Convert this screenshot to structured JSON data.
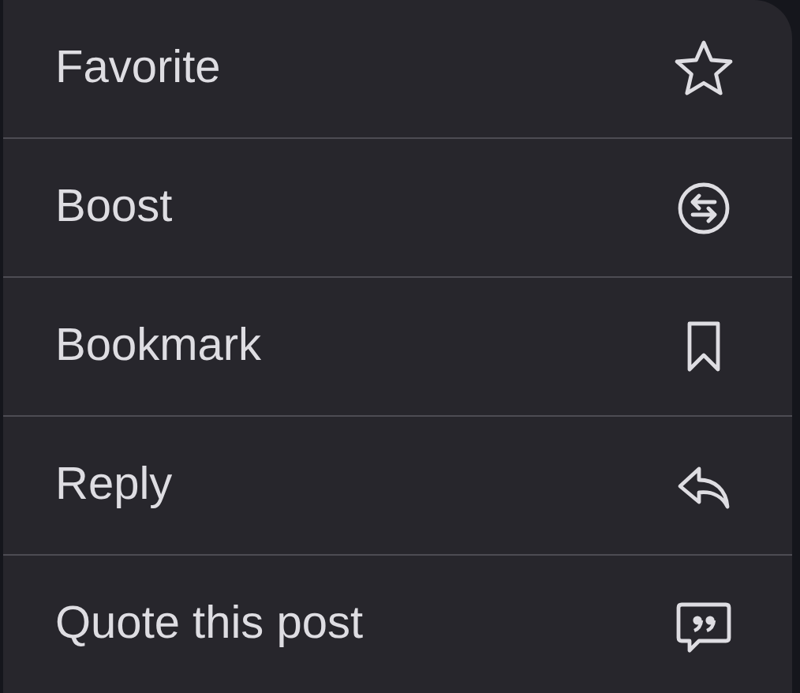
{
  "menu": {
    "items": [
      {
        "label": "Favorite",
        "kind": "star"
      },
      {
        "label": "Boost",
        "kind": "boost"
      },
      {
        "label": "Bookmark",
        "kind": "bookmark"
      },
      {
        "label": "Reply",
        "kind": "reply"
      },
      {
        "label": "Quote this post",
        "kind": "quote"
      }
    ]
  }
}
